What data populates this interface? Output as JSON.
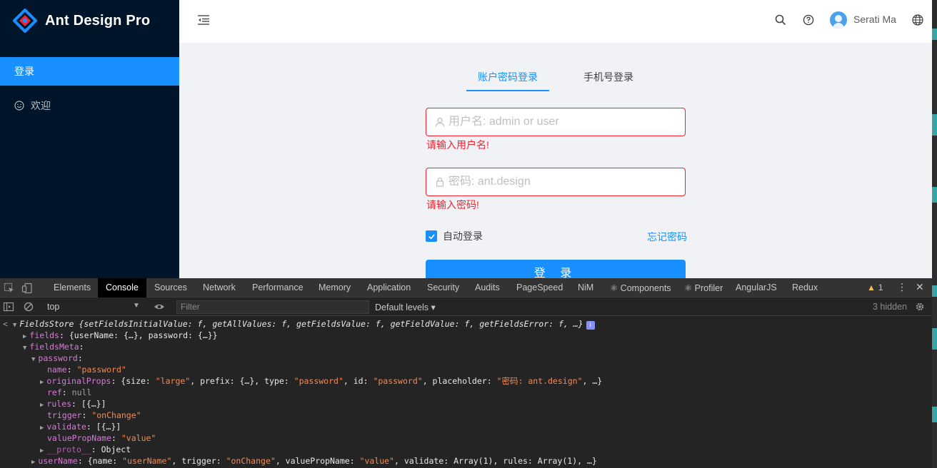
{
  "app": {
    "brand": "Ant Design Pro",
    "menu": [
      {
        "label": "登录",
        "active": true
      },
      {
        "label": "欢迎",
        "active": false
      }
    ],
    "header": {
      "user_name": "Serati Ma"
    },
    "login": {
      "tabs": [
        "账户密码登录",
        "手机号登录"
      ],
      "username_placeholder": "用户名: admin or user",
      "username_error": "请输入用户名!",
      "password_placeholder": "密码: ant.design",
      "password_error": "请输入密码!",
      "remember_label": "自动登录",
      "remember_checked": true,
      "forgot_label": "忘记密码",
      "submit_label": "登 录"
    },
    "colors": {
      "primary": "#1890ff",
      "sider": "#001529",
      "error": "#f5222d"
    }
  },
  "devtools": {
    "tabs": [
      "Elements",
      "Console",
      "Sources",
      "Network",
      "Performance",
      "Memory",
      "Application",
      "Security",
      "Audits",
      "PageSpeed",
      "NiM",
      "⚛ Components",
      "⚛ Profiler",
      "AngularJS",
      "Redux"
    ],
    "active_tab": "Console",
    "warnings": "1",
    "context": "top",
    "filter_placeholder": "Filter",
    "levels": "Default levels ▾",
    "hidden": "3 hidden",
    "console_lines": {
      "l1_name": "FieldsStore",
      "l1_rest": "{setFieldsInitialValue: f, getAllValues: f, getFieldsValue: f, getFieldValue: f, getFieldsError: f, …}",
      "l2_key": "fields",
      "l2_val": "{userName: {…}, password: {…}}",
      "l3_key": "fieldsMeta",
      "l4_key": "password",
      "l5_key": "name",
      "l5_val": "\"password\"",
      "l6_key": "originalProps",
      "l6_a": "{size: ",
      "l6_b": "\"large\"",
      "l6_c": ", prefix: {…}, type: ",
      "l6_d": "\"password\"",
      "l6_e": ", id: ",
      "l6_f": "\"password\"",
      "l6_g": ", placeholder: ",
      "l6_h": "\"密码: ant.design\"",
      "l6_i": ", …}",
      "l7_key": "ref",
      "l7_val": "null",
      "l8_key": "rules",
      "l8_val": "[{…}]",
      "l9_key": "trigger",
      "l9_val": "\"onChange\"",
      "l10_key": "validate",
      "l10_val": "[{…}]",
      "l11_key": "valuePropName",
      "l11_val": "\"value\"",
      "l12_key": "__proto__",
      "l12_val": "Object",
      "l13_key": "userName",
      "l13_a": "{name: ",
      "l13_b": "\"userName\"",
      "l13_c": ", trigger: ",
      "l13_d": "\"onChange\"",
      "l13_e": ", valuePropName: ",
      "l13_f": "\"value\"",
      "l13_g": ", validate: Array(1), rules: Array(1), …}"
    }
  }
}
